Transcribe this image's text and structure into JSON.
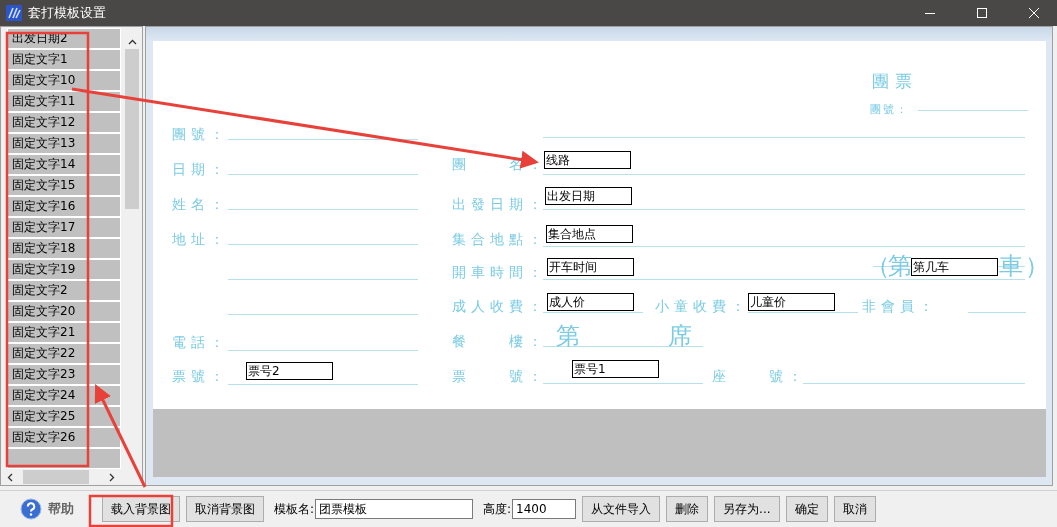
{
  "window": {
    "title": "套打模板设置"
  },
  "field_list": {
    "items": [
      {
        "label": "出发日期2",
        "selected": false
      },
      {
        "label": "固定文字1",
        "selected": false
      },
      {
        "label": "固定文字10",
        "selected": false
      },
      {
        "label": "固定文字11",
        "selected": false
      },
      {
        "label": "固定文字12",
        "selected": false
      },
      {
        "label": "固定文字13",
        "selected": false
      },
      {
        "label": "固定文字14",
        "selected": false
      },
      {
        "label": "固定文字15",
        "selected": false
      },
      {
        "label": "固定文字16",
        "selected": false
      },
      {
        "label": "固定文字17",
        "selected": false
      },
      {
        "label": "固定文字18",
        "selected": false
      },
      {
        "label": "固定文字19",
        "selected": false
      },
      {
        "label": "固定文字2",
        "selected": false
      },
      {
        "label": "固定文字20",
        "selected": false
      },
      {
        "label": "固定文字21",
        "selected": false
      },
      {
        "label": "固定文字22",
        "selected": false
      },
      {
        "label": "固定文字23",
        "selected": false
      },
      {
        "label": "固定文字24",
        "selected": false
      },
      {
        "label": "固定文字25",
        "selected": false
      },
      {
        "label": "固定文字26",
        "selected": false
      }
    ]
  },
  "ticket": {
    "texts": [
      {
        "text": "團票",
        "kind": "title"
      },
      {
        "text": "團號：",
        "kind": "small"
      },
      {
        "text": "團號：",
        "kind": "label"
      },
      {
        "text": "日期：",
        "kind": "label"
      },
      {
        "text": "姓名：",
        "kind": "label"
      },
      {
        "text": "地址：",
        "kind": "label"
      },
      {
        "text": "電話：",
        "kind": "label"
      },
      {
        "text": "票號：",
        "kind": "label"
      },
      {
        "text": "團　　名：",
        "kind": "label"
      },
      {
        "text": "出發日期：",
        "kind": "label"
      },
      {
        "text": "集合地點：",
        "kind": "label"
      },
      {
        "text": "開車時間：",
        "kind": "label"
      },
      {
        "text": "成人收費：",
        "kind": "label"
      },
      {
        "text": "小童收費：",
        "kind": "label"
      },
      {
        "text": "非會員：",
        "kind": "label"
      },
      {
        "text": "餐　　樓：",
        "kind": "label"
      },
      {
        "text": "票　　號：",
        "kind": "label"
      },
      {
        "text": "座　　號：",
        "kind": "label"
      },
      {
        "text": "第",
        "kind": "big"
      },
      {
        "text": "席",
        "kind": "big"
      },
      {
        "text": "（",
        "kind": "big"
      },
      {
        "text": "第",
        "kind": "big"
      },
      {
        "text": "車",
        "kind": "big"
      },
      {
        "text": "）",
        "kind": "big"
      }
    ],
    "fields": [
      {
        "text": "线路"
      },
      {
        "text": "出发日期"
      },
      {
        "text": "集合地点"
      },
      {
        "text": "开车时间"
      },
      {
        "text": "成人价"
      },
      {
        "text": "儿童价"
      },
      {
        "text": "第几车"
      },
      {
        "text": "票号2"
      },
      {
        "text": "票号1"
      }
    ]
  },
  "toolbar": {
    "help": "帮助",
    "buttons_left": [
      "载入背景图",
      "取消背景图"
    ],
    "template_name": {
      "label": "模板名:",
      "value": "团票模板"
    },
    "height": {
      "label": "高度:",
      "value": "1400"
    },
    "buttons_right": [
      "从文件导入",
      "删除",
      "另存为...",
      "确定",
      "取消"
    ]
  }
}
